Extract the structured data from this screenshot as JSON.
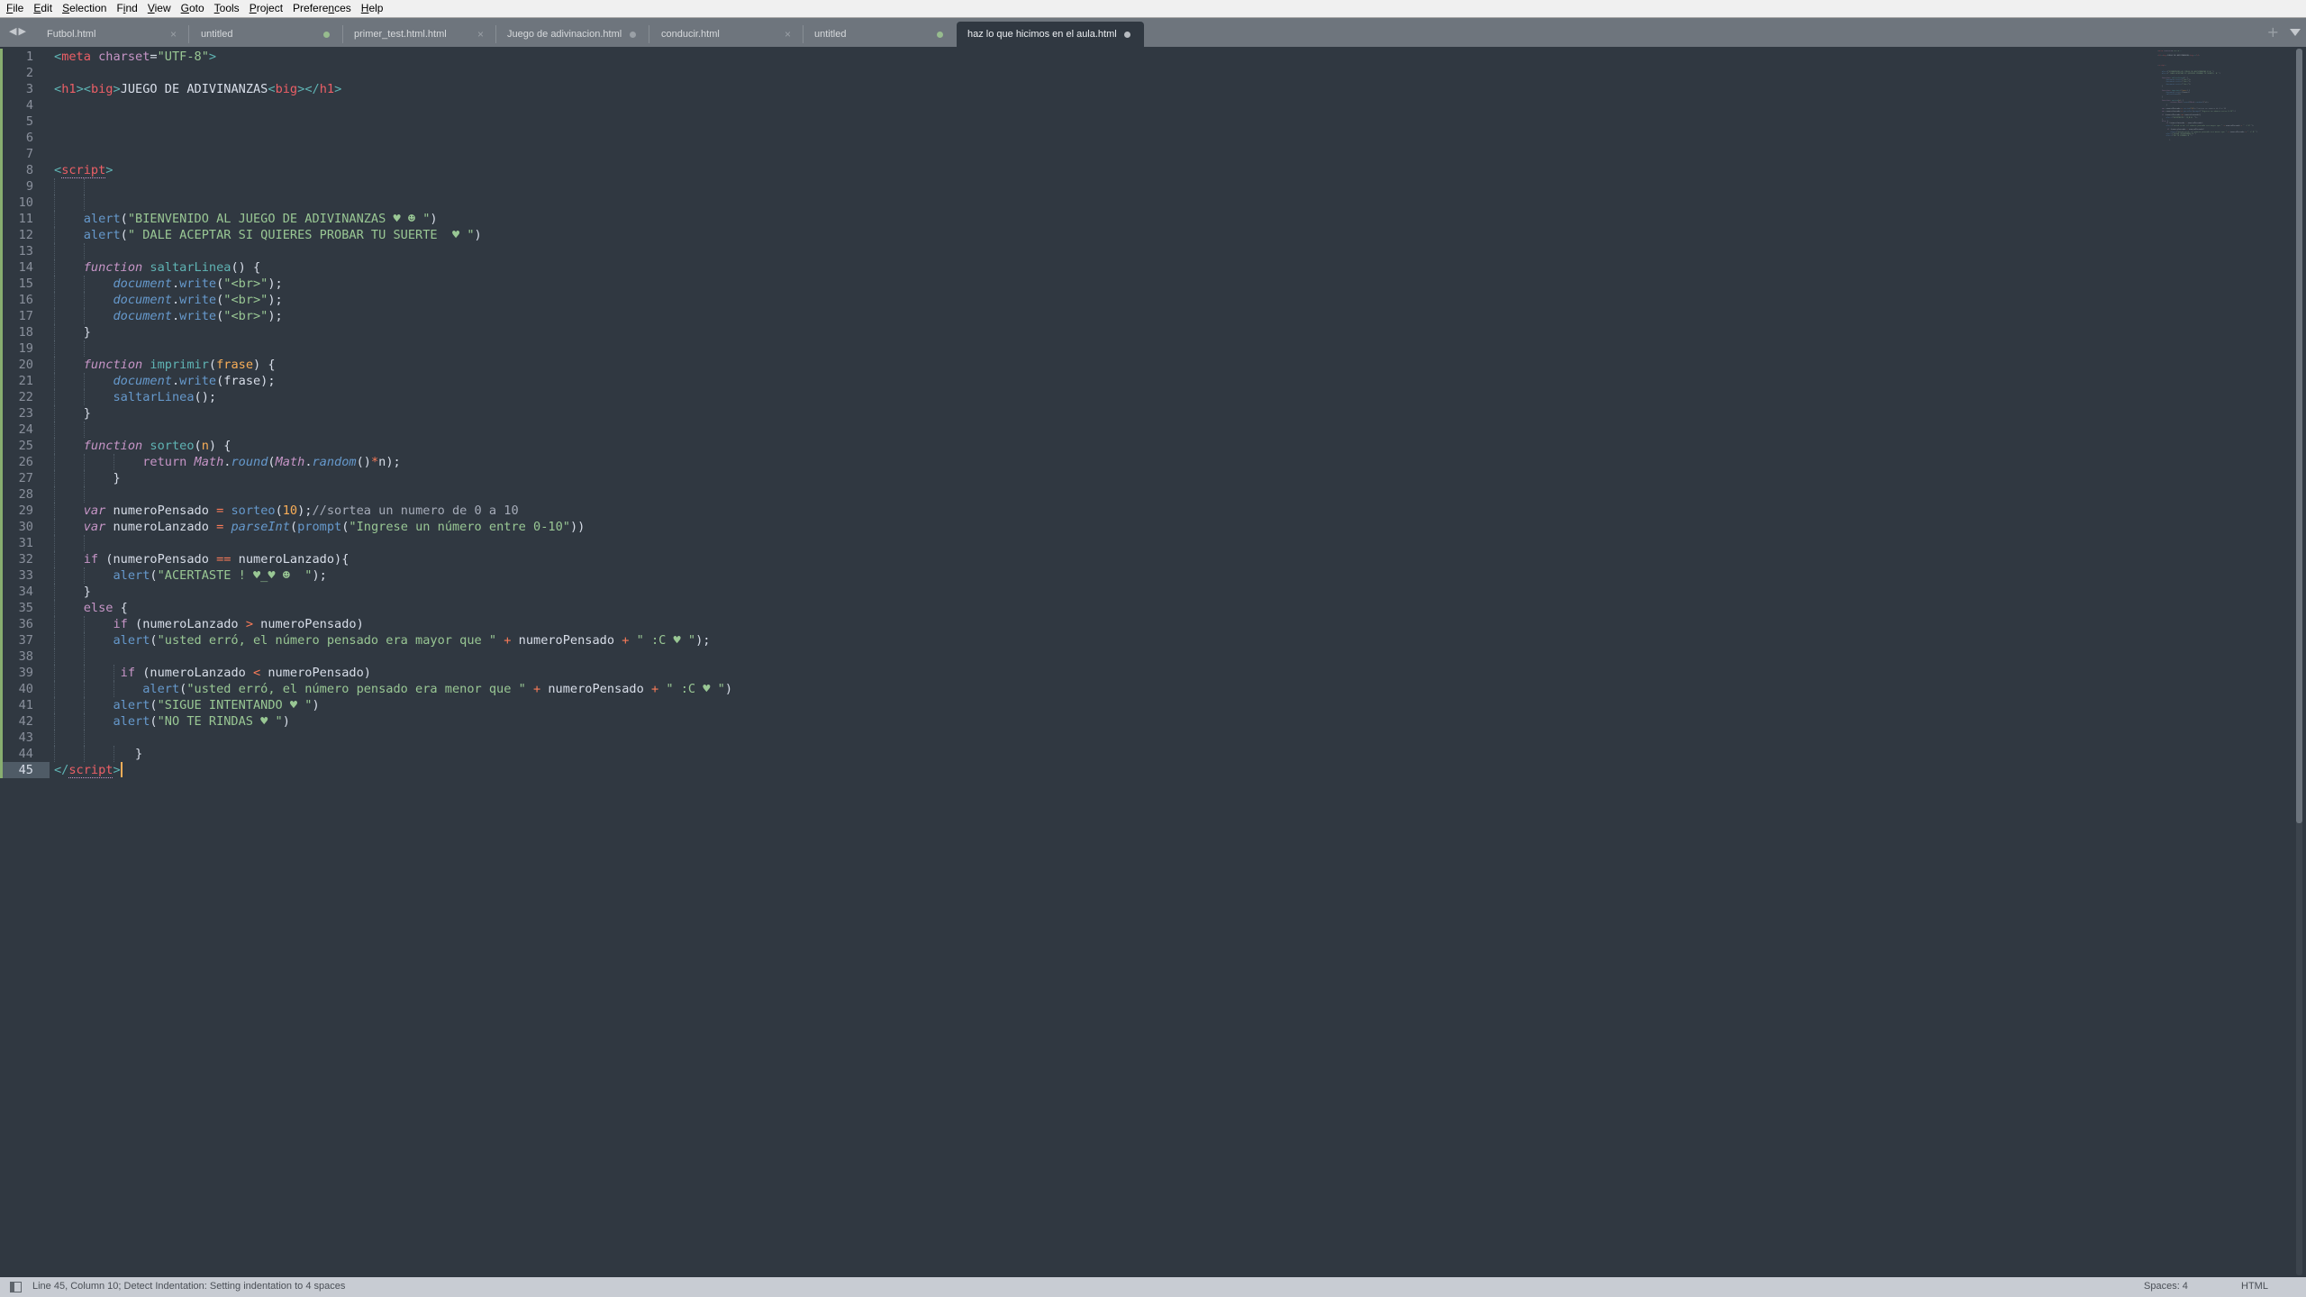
{
  "menu": [
    {
      "label": "File",
      "mnemonic": "F"
    },
    {
      "label": "Edit",
      "mnemonic": "E"
    },
    {
      "label": "Selection",
      "mnemonic": "S"
    },
    {
      "label": "Find",
      "mnemonic": "i"
    },
    {
      "label": "View",
      "mnemonic": "V"
    },
    {
      "label": "Goto",
      "mnemonic": "G"
    },
    {
      "label": "Tools",
      "mnemonic": "T"
    },
    {
      "label": "Project",
      "mnemonic": "P"
    },
    {
      "label": "Preferences",
      "mnemonic": "n"
    },
    {
      "label": "Help",
      "mnemonic": "H"
    }
  ],
  "tabs": [
    {
      "label": "Futbol.html",
      "state": "close"
    },
    {
      "label": "untitled",
      "state": "unsaved"
    },
    {
      "label": "primer_test.html.html",
      "state": "close"
    },
    {
      "label": "Juego de adivinacion.html",
      "state": "dirty"
    },
    {
      "label": "conducir.html",
      "state": "close"
    },
    {
      "label": "untitled",
      "state": "unsaved"
    },
    {
      "label": "haz lo que hicimos en el aula.html",
      "state": "dirty",
      "active": true
    }
  ],
  "tab_icons": {
    "prev": "◀",
    "next": "▶",
    "close": "×",
    "add": "+"
  },
  "editor": {
    "current_line": 45,
    "lines": [
      [
        [
          "t-pun",
          "<"
        ],
        [
          "t-tag",
          "meta"
        ],
        [
          "t-pl",
          " "
        ],
        [
          "t-attr",
          "charset"
        ],
        [
          "t-pl",
          "="
        ],
        [
          "t-str",
          "\"UTF-8\""
        ],
        [
          "t-pun",
          ">"
        ]
      ],
      [],
      [
        [
          "t-pun",
          "<"
        ],
        [
          "t-tag",
          "h1"
        ],
        [
          "t-pun",
          ">"
        ],
        [
          "t-pun",
          "<"
        ],
        [
          "t-tag",
          "big"
        ],
        [
          "t-pun",
          ">"
        ],
        [
          "t-txt",
          "JUEGO DE ADIVINANZAS"
        ],
        [
          "t-pun",
          "<"
        ],
        [
          "t-tag",
          "big"
        ],
        [
          "t-pun",
          ">"
        ],
        [
          "t-pun",
          "</"
        ],
        [
          "t-tag",
          "h1"
        ],
        [
          "t-pun",
          ">"
        ]
      ],
      [],
      [],
      [],
      [],
      [
        [
          "t-pun",
          "<"
        ],
        [
          "t-tag",
          "script"
        ],
        [
          "t-pun",
          ">"
        ]
      ],
      [],
      [],
      [
        [
          "t-pl",
          "    "
        ],
        [
          "t-meth",
          "alert"
        ],
        [
          "t-pl",
          "("
        ],
        [
          "t-str",
          "\"BIENVENIDO AL JUEGO DE ADIVINANZAS ♥ ☻ \""
        ],
        [
          "t-pl",
          ")"
        ]
      ],
      [
        [
          "t-pl",
          "    "
        ],
        [
          "t-meth",
          "alert"
        ],
        [
          "t-pl",
          "("
        ],
        [
          "t-str",
          "\" DALE ACEPTAR SI QUIERES PROBAR TU SUERTE  ♥ \""
        ],
        [
          "t-pl",
          ")"
        ]
      ],
      [],
      [
        [
          "t-pl",
          "    "
        ],
        [
          "t-kw",
          "function"
        ],
        [
          "t-pl",
          " "
        ],
        [
          "t-fn",
          "saltarLinea"
        ],
        [
          "t-pl",
          "() {"
        ]
      ],
      [
        [
          "t-pl",
          "        "
        ],
        [
          "t-obj",
          "document"
        ],
        [
          "t-pl",
          "."
        ],
        [
          "t-meth",
          "write"
        ],
        [
          "t-pl",
          "("
        ],
        [
          "t-str",
          "\"<br>\""
        ],
        [
          "t-pl",
          ");"
        ]
      ],
      [
        [
          "t-pl",
          "        "
        ],
        [
          "t-obj",
          "document"
        ],
        [
          "t-pl",
          "."
        ],
        [
          "t-meth",
          "write"
        ],
        [
          "t-pl",
          "("
        ],
        [
          "t-str",
          "\"<br>\""
        ],
        [
          "t-pl",
          ");"
        ]
      ],
      [
        [
          "t-pl",
          "        "
        ],
        [
          "t-obj",
          "document"
        ],
        [
          "t-pl",
          "."
        ],
        [
          "t-meth",
          "write"
        ],
        [
          "t-pl",
          "("
        ],
        [
          "t-str",
          "\"<br>\""
        ],
        [
          "t-pl",
          ");"
        ]
      ],
      [
        [
          "t-pl",
          "    }"
        ]
      ],
      [],
      [
        [
          "t-pl",
          "    "
        ],
        [
          "t-kw",
          "function"
        ],
        [
          "t-pl",
          " "
        ],
        [
          "t-fn",
          "imprimir"
        ],
        [
          "t-pl",
          "("
        ],
        [
          "t-par",
          "frase"
        ],
        [
          "t-pl",
          ") {"
        ]
      ],
      [
        [
          "t-pl",
          "        "
        ],
        [
          "t-obj",
          "document"
        ],
        [
          "t-pl",
          "."
        ],
        [
          "t-meth",
          "write"
        ],
        [
          "t-pl",
          "(frase);"
        ]
      ],
      [
        [
          "t-pl",
          "        "
        ],
        [
          "t-meth",
          "saltarLinea"
        ],
        [
          "t-pl",
          "();"
        ]
      ],
      [
        [
          "t-pl",
          "    }"
        ]
      ],
      [],
      [
        [
          "t-pl",
          "    "
        ],
        [
          "t-kw",
          "function"
        ],
        [
          "t-pl",
          " "
        ],
        [
          "t-fn",
          "sorteo"
        ],
        [
          "t-pl",
          "("
        ],
        [
          "t-par",
          "n"
        ],
        [
          "t-pl",
          ") {"
        ]
      ],
      [
        [
          "t-pl",
          "            "
        ],
        [
          "t-kw2",
          "return"
        ],
        [
          "t-pl",
          " "
        ],
        [
          "t-cls",
          "Math"
        ],
        [
          "t-pl",
          "."
        ],
        [
          "t-obj",
          "round"
        ],
        [
          "t-pl",
          "("
        ],
        [
          "t-cls",
          "Math"
        ],
        [
          "t-pl",
          "."
        ],
        [
          "t-obj",
          "random"
        ],
        [
          "t-pl",
          "()"
        ],
        [
          "t-op",
          "*"
        ],
        [
          "t-pl",
          "n);"
        ]
      ],
      [
        [
          "t-pl",
          "        }"
        ]
      ],
      [],
      [
        [
          "t-pl",
          "    "
        ],
        [
          "t-kw",
          "var"
        ],
        [
          "t-pl",
          " numeroPensado "
        ],
        [
          "t-op",
          "="
        ],
        [
          "t-pl",
          " "
        ],
        [
          "t-meth",
          "sorteo"
        ],
        [
          "t-pl",
          "("
        ],
        [
          "t-num",
          "10"
        ],
        [
          "t-pl",
          ");"
        ],
        [
          "t-cmt",
          "//sortea un numero de 0 a 10"
        ]
      ],
      [
        [
          "t-pl",
          "    "
        ],
        [
          "t-kw",
          "var"
        ],
        [
          "t-pl",
          " numeroLanzado "
        ],
        [
          "t-op",
          "="
        ],
        [
          "t-pl",
          " "
        ],
        [
          "t-obj",
          "parseInt"
        ],
        [
          "t-pl",
          "("
        ],
        [
          "t-meth",
          "prompt"
        ],
        [
          "t-pl",
          "("
        ],
        [
          "t-str",
          "\"Ingrese un número entre 0-10\""
        ],
        [
          "t-pl",
          "))"
        ]
      ],
      [],
      [
        [
          "t-pl",
          "    "
        ],
        [
          "t-kw2",
          "if"
        ],
        [
          "t-pl",
          " (numeroPensado "
        ],
        [
          "t-op",
          "=="
        ],
        [
          "t-pl",
          " numeroLanzado){"
        ]
      ],
      [
        [
          "t-pl",
          "        "
        ],
        [
          "t-meth",
          "alert"
        ],
        [
          "t-pl",
          "("
        ],
        [
          "t-str",
          "\"ACERTASTE ! ♥_♥ ☻  \""
        ],
        [
          "t-pl",
          ");"
        ]
      ],
      [
        [
          "t-pl",
          "    }"
        ]
      ],
      [
        [
          "t-pl",
          "    "
        ],
        [
          "t-kw2",
          "else"
        ],
        [
          "t-pl",
          " {"
        ]
      ],
      [
        [
          "t-pl",
          "        "
        ],
        [
          "t-kw2",
          "if"
        ],
        [
          "t-pl",
          " (numeroLanzado "
        ],
        [
          "t-op",
          ">"
        ],
        [
          "t-pl",
          " numeroPensado)"
        ]
      ],
      [
        [
          "t-pl",
          "        "
        ],
        [
          "t-meth",
          "alert"
        ],
        [
          "t-pl",
          "("
        ],
        [
          "t-str",
          "\"usted erró, el número pensado era mayor que \""
        ],
        [
          "t-pl",
          " "
        ],
        [
          "t-op",
          "+"
        ],
        [
          "t-pl",
          " numeroPensado "
        ],
        [
          "t-op",
          "+"
        ],
        [
          "t-pl",
          " "
        ],
        [
          "t-str",
          "\" :C ♥ \""
        ],
        [
          "t-pl",
          ");"
        ]
      ],
      [],
      [
        [
          "t-pl",
          "         "
        ],
        [
          "t-kw2",
          "if"
        ],
        [
          "t-pl",
          " (numeroLanzado "
        ],
        [
          "t-op",
          "<"
        ],
        [
          "t-pl",
          " numeroPensado)"
        ]
      ],
      [
        [
          "t-pl",
          "            "
        ],
        [
          "t-meth",
          "alert"
        ],
        [
          "t-pl",
          "("
        ],
        [
          "t-str",
          "\"usted erró, el número pensado era menor que \""
        ],
        [
          "t-pl",
          " "
        ],
        [
          "t-op",
          "+"
        ],
        [
          "t-pl",
          " numeroPensado "
        ],
        [
          "t-op",
          "+"
        ],
        [
          "t-pl",
          " "
        ],
        [
          "t-str",
          "\" :C ♥ \""
        ],
        [
          "t-pl",
          ")"
        ]
      ],
      [
        [
          "t-pl",
          "        "
        ],
        [
          "t-meth",
          "alert"
        ],
        [
          "t-pl",
          "("
        ],
        [
          "t-str",
          "\"SIGUE INTENTANDO ♥ \""
        ],
        [
          "t-pl",
          ")"
        ]
      ],
      [
        [
          "t-pl",
          "        "
        ],
        [
          "t-meth",
          "alert"
        ],
        [
          "t-pl",
          "("
        ],
        [
          "t-str",
          "\"NO TE RINDAS ♥ \""
        ],
        [
          "t-pl",
          ")"
        ]
      ],
      [],
      [
        [
          "t-pl",
          "           }"
        ]
      ],
      [
        [
          "t-pun",
          "</"
        ],
        [
          "t-tag",
          "script"
        ],
        [
          "t-pun",
          ">"
        ]
      ]
    ]
  },
  "status": {
    "message": "Line 45, Column 10; Detect Indentation: Setting indentation to 4 spaces",
    "indentation": "Spaces: 4",
    "syntax": "HTML"
  }
}
